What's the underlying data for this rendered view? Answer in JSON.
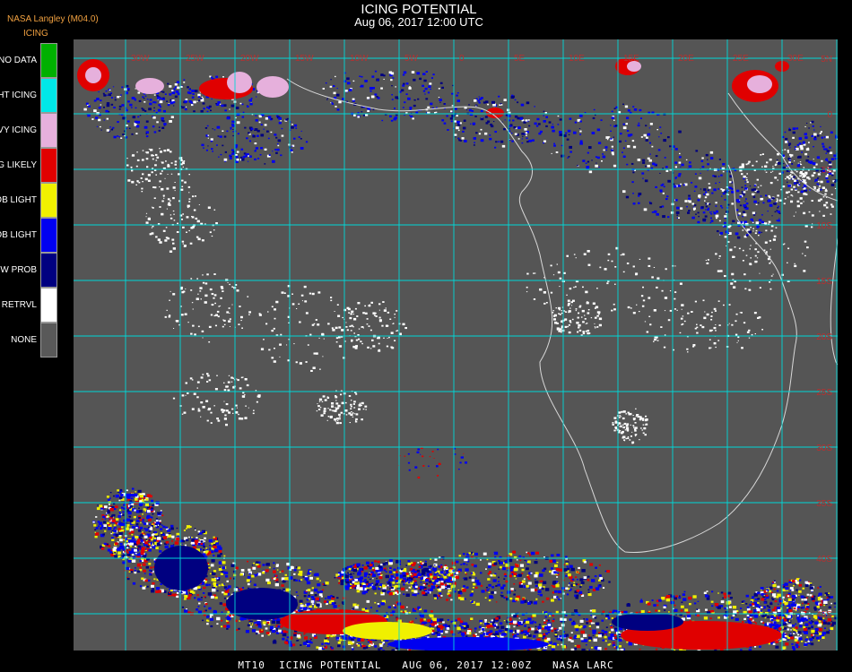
{
  "header": {
    "title": "ICING POTENTIAL",
    "subtitle": "Aug 06, 2017 12:00 UTC",
    "source": "NASA Langley (M04.0)",
    "product": "ICING"
  },
  "legend": [
    {
      "label": "NO DATA",
      "color": "#00b000"
    },
    {
      "label": "NIGHT ICING",
      "color": "#00e8e8"
    },
    {
      "label": "HEAVY ICING",
      "color": "#e6b0dc"
    },
    {
      "label": "MOG LIKELY",
      "color": "#e00000"
    },
    {
      "label": "HI PROB LIGHT",
      "color": "#f0f000"
    },
    {
      "label": "LO PROB LIGHT",
      "color": "#0000f0"
    },
    {
      "label": "LOW PROB",
      "color": "#000080"
    },
    {
      "label": "NO RETRVL",
      "color": "#ffffff"
    },
    {
      "label": "NONE",
      "color": "#595959"
    }
  ],
  "map": {
    "background_color": "#555555",
    "grid_color": "#00d8d8",
    "coast_color": "#d8d8d8",
    "label_color": "#b83030",
    "lon_labels": [
      "30W",
      "25W",
      "20W",
      "15W",
      "10W",
      "5W",
      "0",
      "5E",
      "10E",
      "15E",
      "20E",
      "25E",
      "30E",
      "35E",
      "40E"
    ],
    "lat_labels": [
      "5N",
      "0",
      "5S",
      "10S",
      "15S",
      "20S",
      "25S",
      "30S",
      "35S",
      "40S",
      "45S",
      "50S"
    ]
  },
  "footer": "MT10  ICING POTENTIAL   AUG 06, 2017 12:00Z   NASA LARC"
}
